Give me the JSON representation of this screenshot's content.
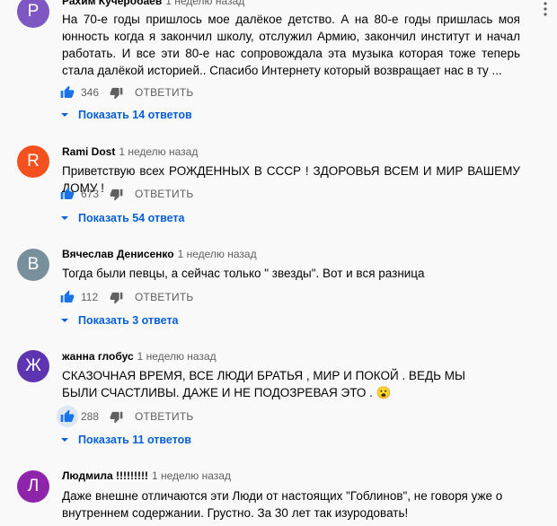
{
  "comments": [
    {
      "avatar_letter": "P",
      "avatar_color": "#7e57c2",
      "author": "Рахим Кучеробаев",
      "time": "1 неделю назад",
      "text": "На 70-е годы пришлось мое далёкое детство. А на 80-е годы пришлась моя юнность когда я закончил школу, отслужил Армию, закончил институт и начал работать. И все эти 80-е нас сопровождала эта музыка которая тоже теперь стала далёкой историей.. Спасибо Интернету который возвращает нас в ту ...",
      "likes": "346",
      "reply_label": "ОТВЕТИТЬ",
      "replies_label": "Показать 14 ответов",
      "liked": false
    },
    {
      "avatar_letter": "R",
      "avatar_color": "#f4511e",
      "author": "Rami Dost",
      "time": "1 неделю назад",
      "text": "Приветствую всех РОЖДЕННЫХ В СССР ! ЗДОРОВЬЯ ВСЕМ И МИР ВАШЕМУ ДОМУ !",
      "likes": "673",
      "reply_label": "ОТВЕТИТЬ",
      "replies_label": "Показать 54 ответа",
      "liked": false
    },
    {
      "avatar_letter": "В",
      "avatar_color": "#78909c",
      "author": "Вячеслав Денисенко",
      "time": "1 неделю назад",
      "text": "Тогда были певцы, а сейчас только \" звезды\". Вот и вся разница",
      "likes": "112",
      "reply_label": "ОТВЕТИТЬ",
      "replies_label": "Показать 3 ответа",
      "liked": false
    },
    {
      "avatar_letter": "Ж",
      "avatar_color": "#5e35b1",
      "author": "жанна глобус",
      "time": "1 неделю назад",
      "text": "СКАЗОЧНАЯ ВРЕМЯ, ВСЕ ЛЮДИ БРАТЬЯ , МИР И ПОКОЙ . ВЕДЬ МЫ БЫЛИ СЧАСТЛИВЫ. ДАЖЕ И НЕ ПОДОЗРЕВАЯ ЭТО . 😮",
      "likes": "288",
      "reply_label": "ОТВЕТИТЬ",
      "replies_label": "Показать 11 ответов",
      "liked": true
    },
    {
      "avatar_letter": "Л",
      "avatar_color": "#8e24aa",
      "author": "Людмила !!!!!!!!!",
      "time": "1 неделю назад",
      "text": "Даже внешне отличаются эти Люди от настоящих \"Гоблинов\", не говоря уже о внутреннем содержании. Грустно. За 30 лет так изуродовать!",
      "likes": "",
      "reply_label": "",
      "replies_label": "",
      "liked": false
    }
  ],
  "colors": {
    "link": "#065fd4",
    "secondary_text": "#606060",
    "like_active_bg": "#dde6f1"
  }
}
